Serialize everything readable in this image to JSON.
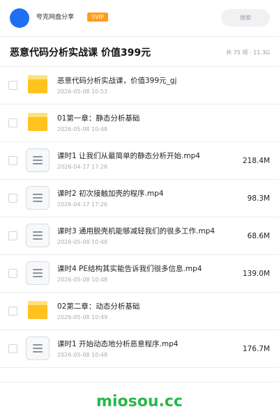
{
  "header": {
    "share_title": "夸克网盘分享",
    "badge": "SVIP",
    "search_placeholder": "搜索"
  },
  "share": {
    "title": "恶意代码分析实战课 价值399元",
    "meta": "共 75 项 · 11.3G"
  },
  "files": [
    {
      "type": "folder",
      "name": "恶意代码分析实战课，价值399元_gj",
      "date": "2026-05-08 10:53",
      "size": ""
    },
    {
      "type": "folder",
      "name": "01第一章：静态分析基础",
      "date": "2026-05-08 10:48",
      "size": ""
    },
    {
      "type": "video",
      "name": "课时1 让我们从最简单的静态分析开始.mp4",
      "date": "2026-04-17 17:26",
      "size": "218.4M"
    },
    {
      "type": "video",
      "name": "课时2 初次接触加壳的程序.mp4",
      "date": "2026-04-17 17:26",
      "size": "98.3M"
    },
    {
      "type": "video",
      "name": "课时3 通用脱壳机能够减轻我们的很多工作.mp4",
      "date": "2026-05-08 10:48",
      "size": "68.6M"
    },
    {
      "type": "video",
      "name": "课时4 PE结构其实能告诉我们很多信息.mp4",
      "date": "2026-05-08 10:48",
      "size": "139.0M"
    },
    {
      "type": "folder",
      "name": "02第二章：动态分析基础",
      "date": "2026-05-08 10:49",
      "size": ""
    },
    {
      "type": "video",
      "name": "课时1 开始动态地分析恶意程序.mp4",
      "date": "2026-05-08 10:48",
      "size": "176.7M"
    }
  ],
  "watermark": "miosou.cc",
  "colors": {
    "accent": "#1f6ff2",
    "badge": "#ff9c1a",
    "folder": "#ffc21f",
    "watermark": "#27b84a"
  }
}
